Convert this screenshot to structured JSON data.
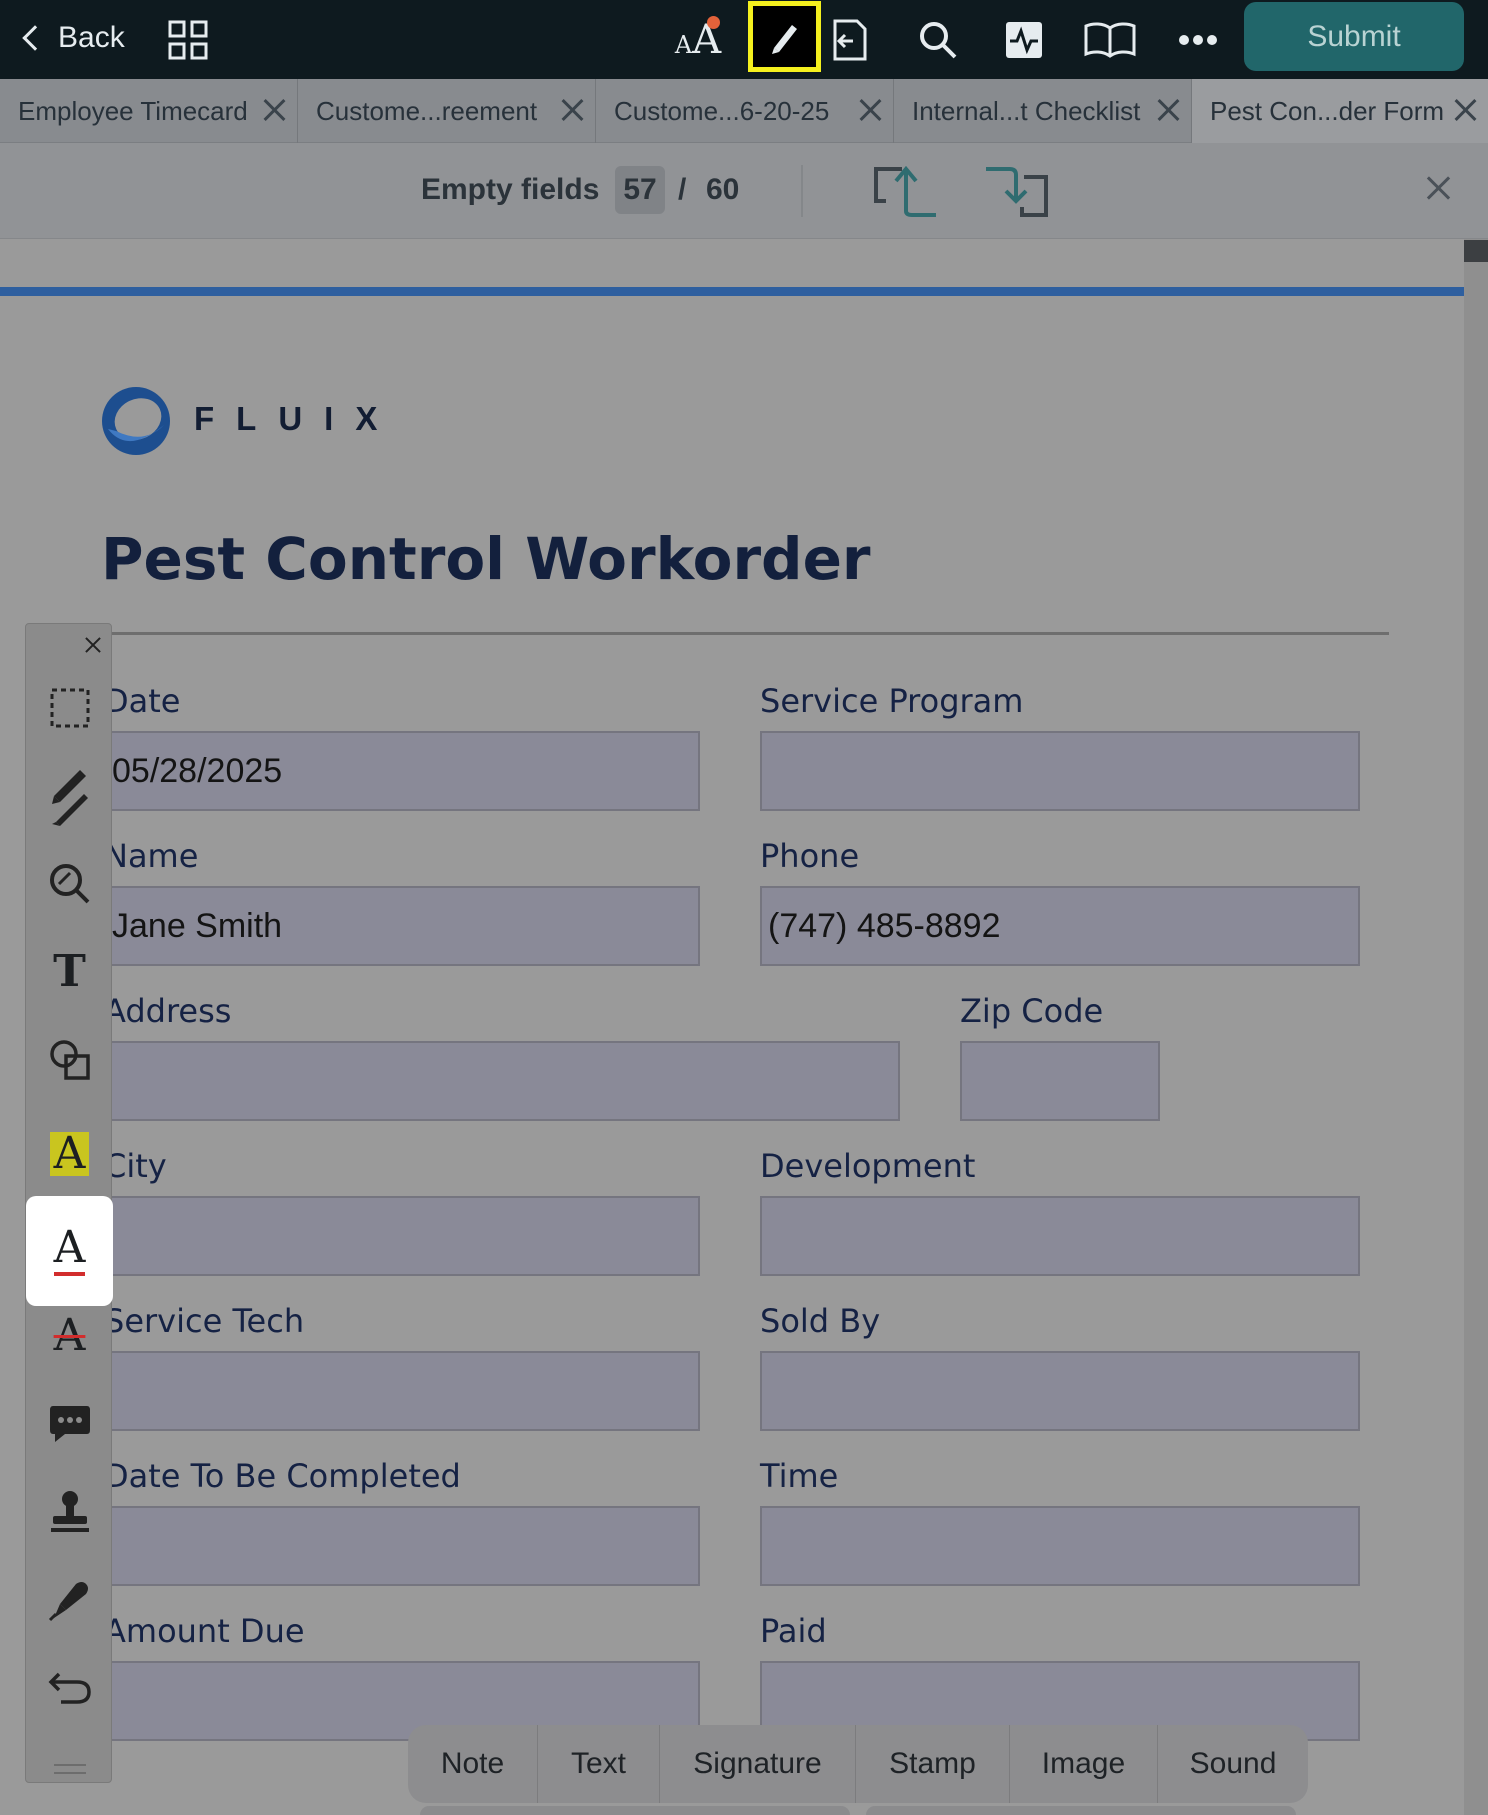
{
  "topbar": {
    "back_label": "Back",
    "submit_label": "Submit",
    "text_size_glyph": "AA",
    "icons": [
      "grid-icon",
      "text-size-icon",
      "pen-icon",
      "export-icon",
      "search-icon",
      "activity-icon",
      "book-icon",
      "more-icon"
    ]
  },
  "tabs": [
    {
      "label": "Employee Timecard"
    },
    {
      "label": "Custome...reement"
    },
    {
      "label": "Custome...6-20-25"
    },
    {
      "label": "Internal...t Checklist"
    },
    {
      "label": "Pest Con...der Form"
    }
  ],
  "fields_bar": {
    "label": "Empty fields",
    "empty_count": "57",
    "separator": "/",
    "total": "60"
  },
  "document": {
    "logo_text": "FLUIX",
    "title": "Pest Control Workorder",
    "fields": {
      "date": {
        "label": "Date",
        "value": "05/28/2025"
      },
      "service_program": {
        "label": "Service Program",
        "value": ""
      },
      "name": {
        "label": "Name",
        "value": "Jane Smith"
      },
      "phone": {
        "label": "Phone",
        "value": "(747) 485-8892"
      },
      "address": {
        "label": "Address",
        "value": ""
      },
      "zip_code": {
        "label": "Zip Code",
        "value": ""
      },
      "city": {
        "label": "City",
        "value": ""
      },
      "development": {
        "label": "Development",
        "value": ""
      },
      "service_tech": {
        "label": "Service Tech",
        "value": ""
      },
      "sold_by": {
        "label": "Sold By",
        "value": ""
      },
      "date_to_be_completed": {
        "label": "Date To Be Completed",
        "value": ""
      },
      "time": {
        "label": "Time",
        "value": ""
      },
      "amount_due": {
        "label": "Amount Due",
        "value": ""
      },
      "paid": {
        "label": "Paid",
        "value": ""
      }
    }
  },
  "palette": {
    "glyph_text": "T",
    "glyph_highlight": "A",
    "glyph_underline": "A",
    "glyph_strike": "A",
    "tools": [
      "selection-tool",
      "pencil-tool",
      "zoom-tool",
      "text-tool",
      "shapes-tool",
      "highlight-tool",
      "underline-tool",
      "strikethrough-tool",
      "comment-tool",
      "stamp-tool",
      "signature-pen-tool",
      "undo-tool"
    ],
    "selected": "underline-tool"
  },
  "insert_bar": {
    "items": [
      "Note",
      "Text",
      "Signature",
      "Stamp",
      "Image",
      "Sound"
    ]
  },
  "colors": {
    "accent": "#21666a",
    "highlight_border": "#f4f01e",
    "brand_blue": "#2e5f9f",
    "badge": "#e2623a"
  }
}
